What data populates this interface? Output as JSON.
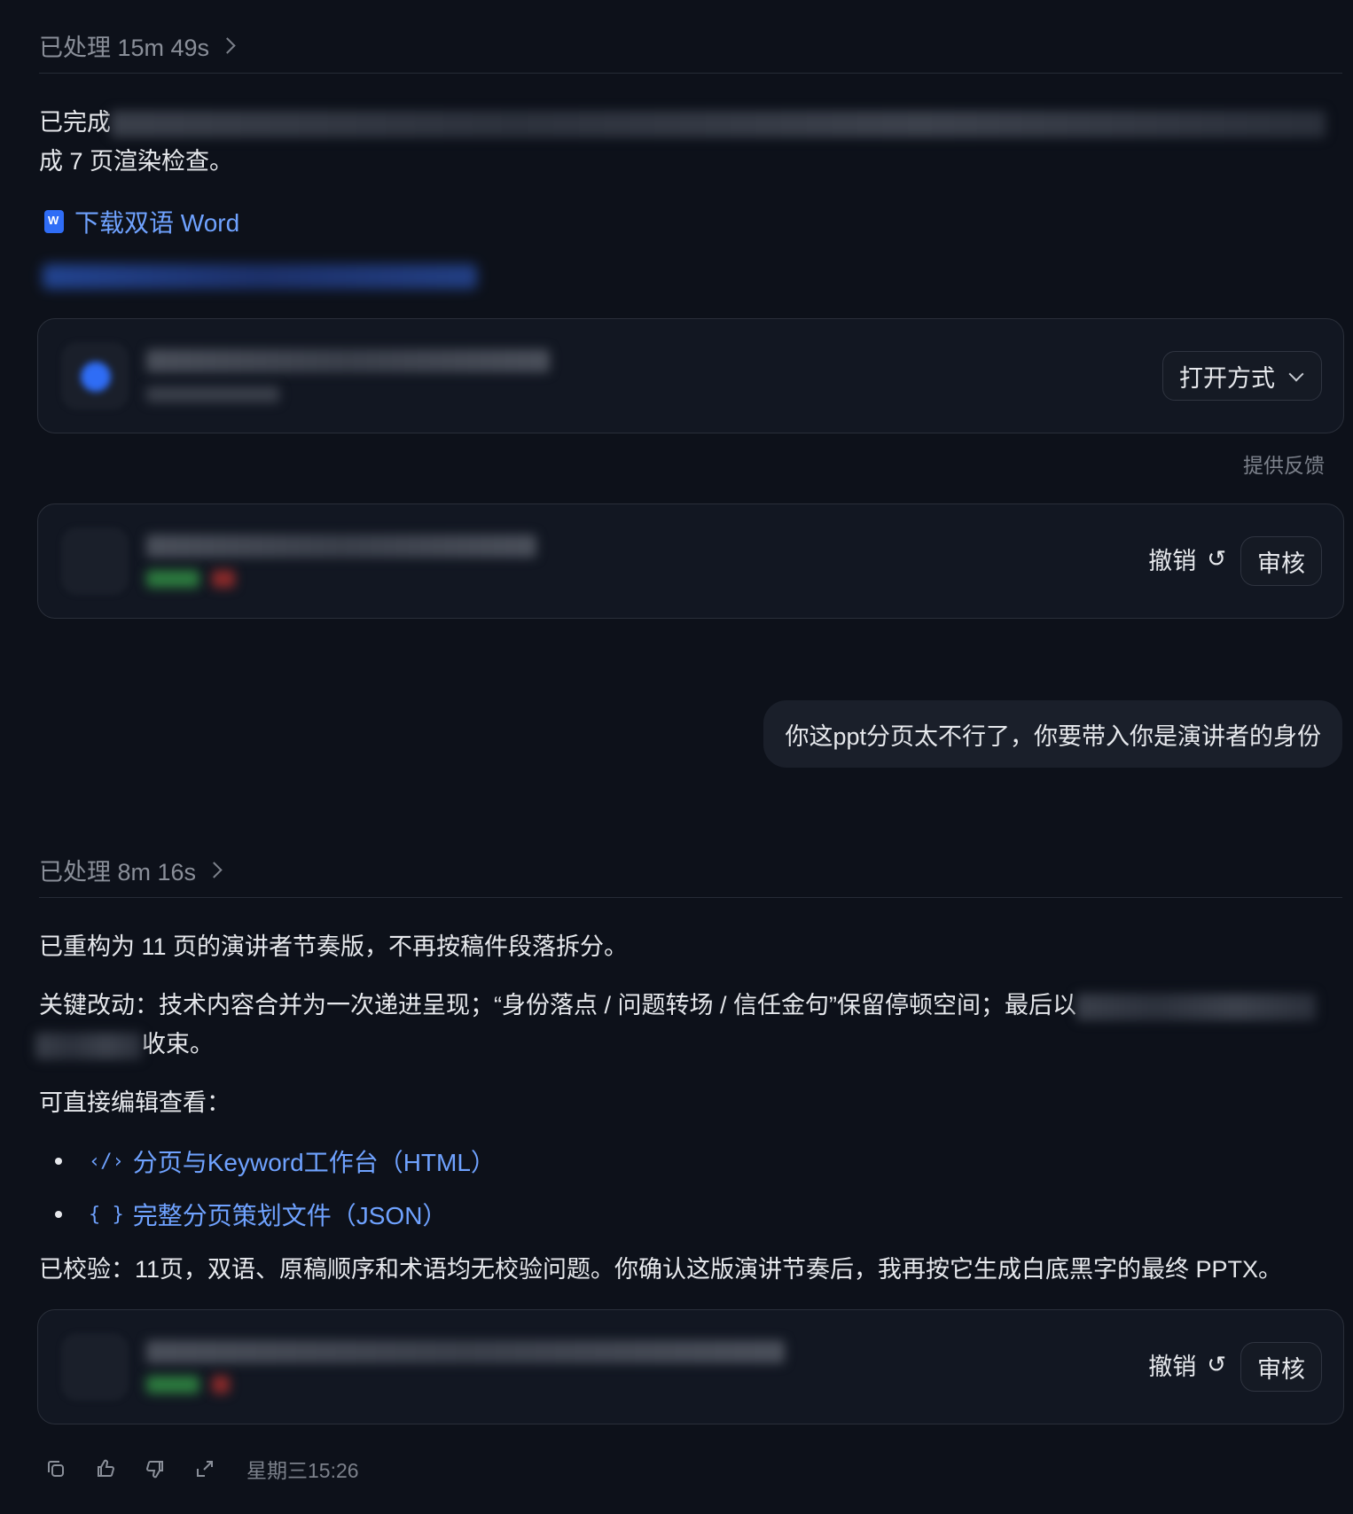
{
  "block1": {
    "processed": "已处理 15m 49s",
    "summary_prefix": "已完成",
    "summary_tail": "成 7 页渲染检查。",
    "download_link": "下载双语 Word",
    "open_with": "打开方式",
    "feedback": "提供反馈",
    "undo": "撤销",
    "review": "审核"
  },
  "user_message": "你这ppt分页太不行了，你要带入你是演讲者的身份",
  "block2": {
    "processed": "已处理 8m 16s",
    "p1": "已重构为 11 页的演讲者节奏版，不再按稿件段落拆分。",
    "p2_prefix": "关键改动：技术内容合并为一次递进呈现；“身份落点 / 问题转场 / 信任金句”保留停顿空间；最后以",
    "p2_tail": "收束。",
    "p3": "可直接编辑查看：",
    "links": [
      {
        "icon": "code-icon",
        "label": "分页与Keyword工作台（HTML）"
      },
      {
        "icon": "braces-icon",
        "label": "完整分页策划文件（JSON）"
      }
    ],
    "p4": "已校验：11页，双语、原稿顺序和术语均无校验问题。你确认这版演讲节奏后，我再按它生成白底黑字的最终 PPTX。",
    "undo": "撤销",
    "review": "审核"
  },
  "footer": {
    "timestamp": "星期三15:26"
  },
  "colors": {
    "background": "#0d111a",
    "link": "#6fa2ff",
    "card": "#121722",
    "muted": "#8a8f99"
  }
}
